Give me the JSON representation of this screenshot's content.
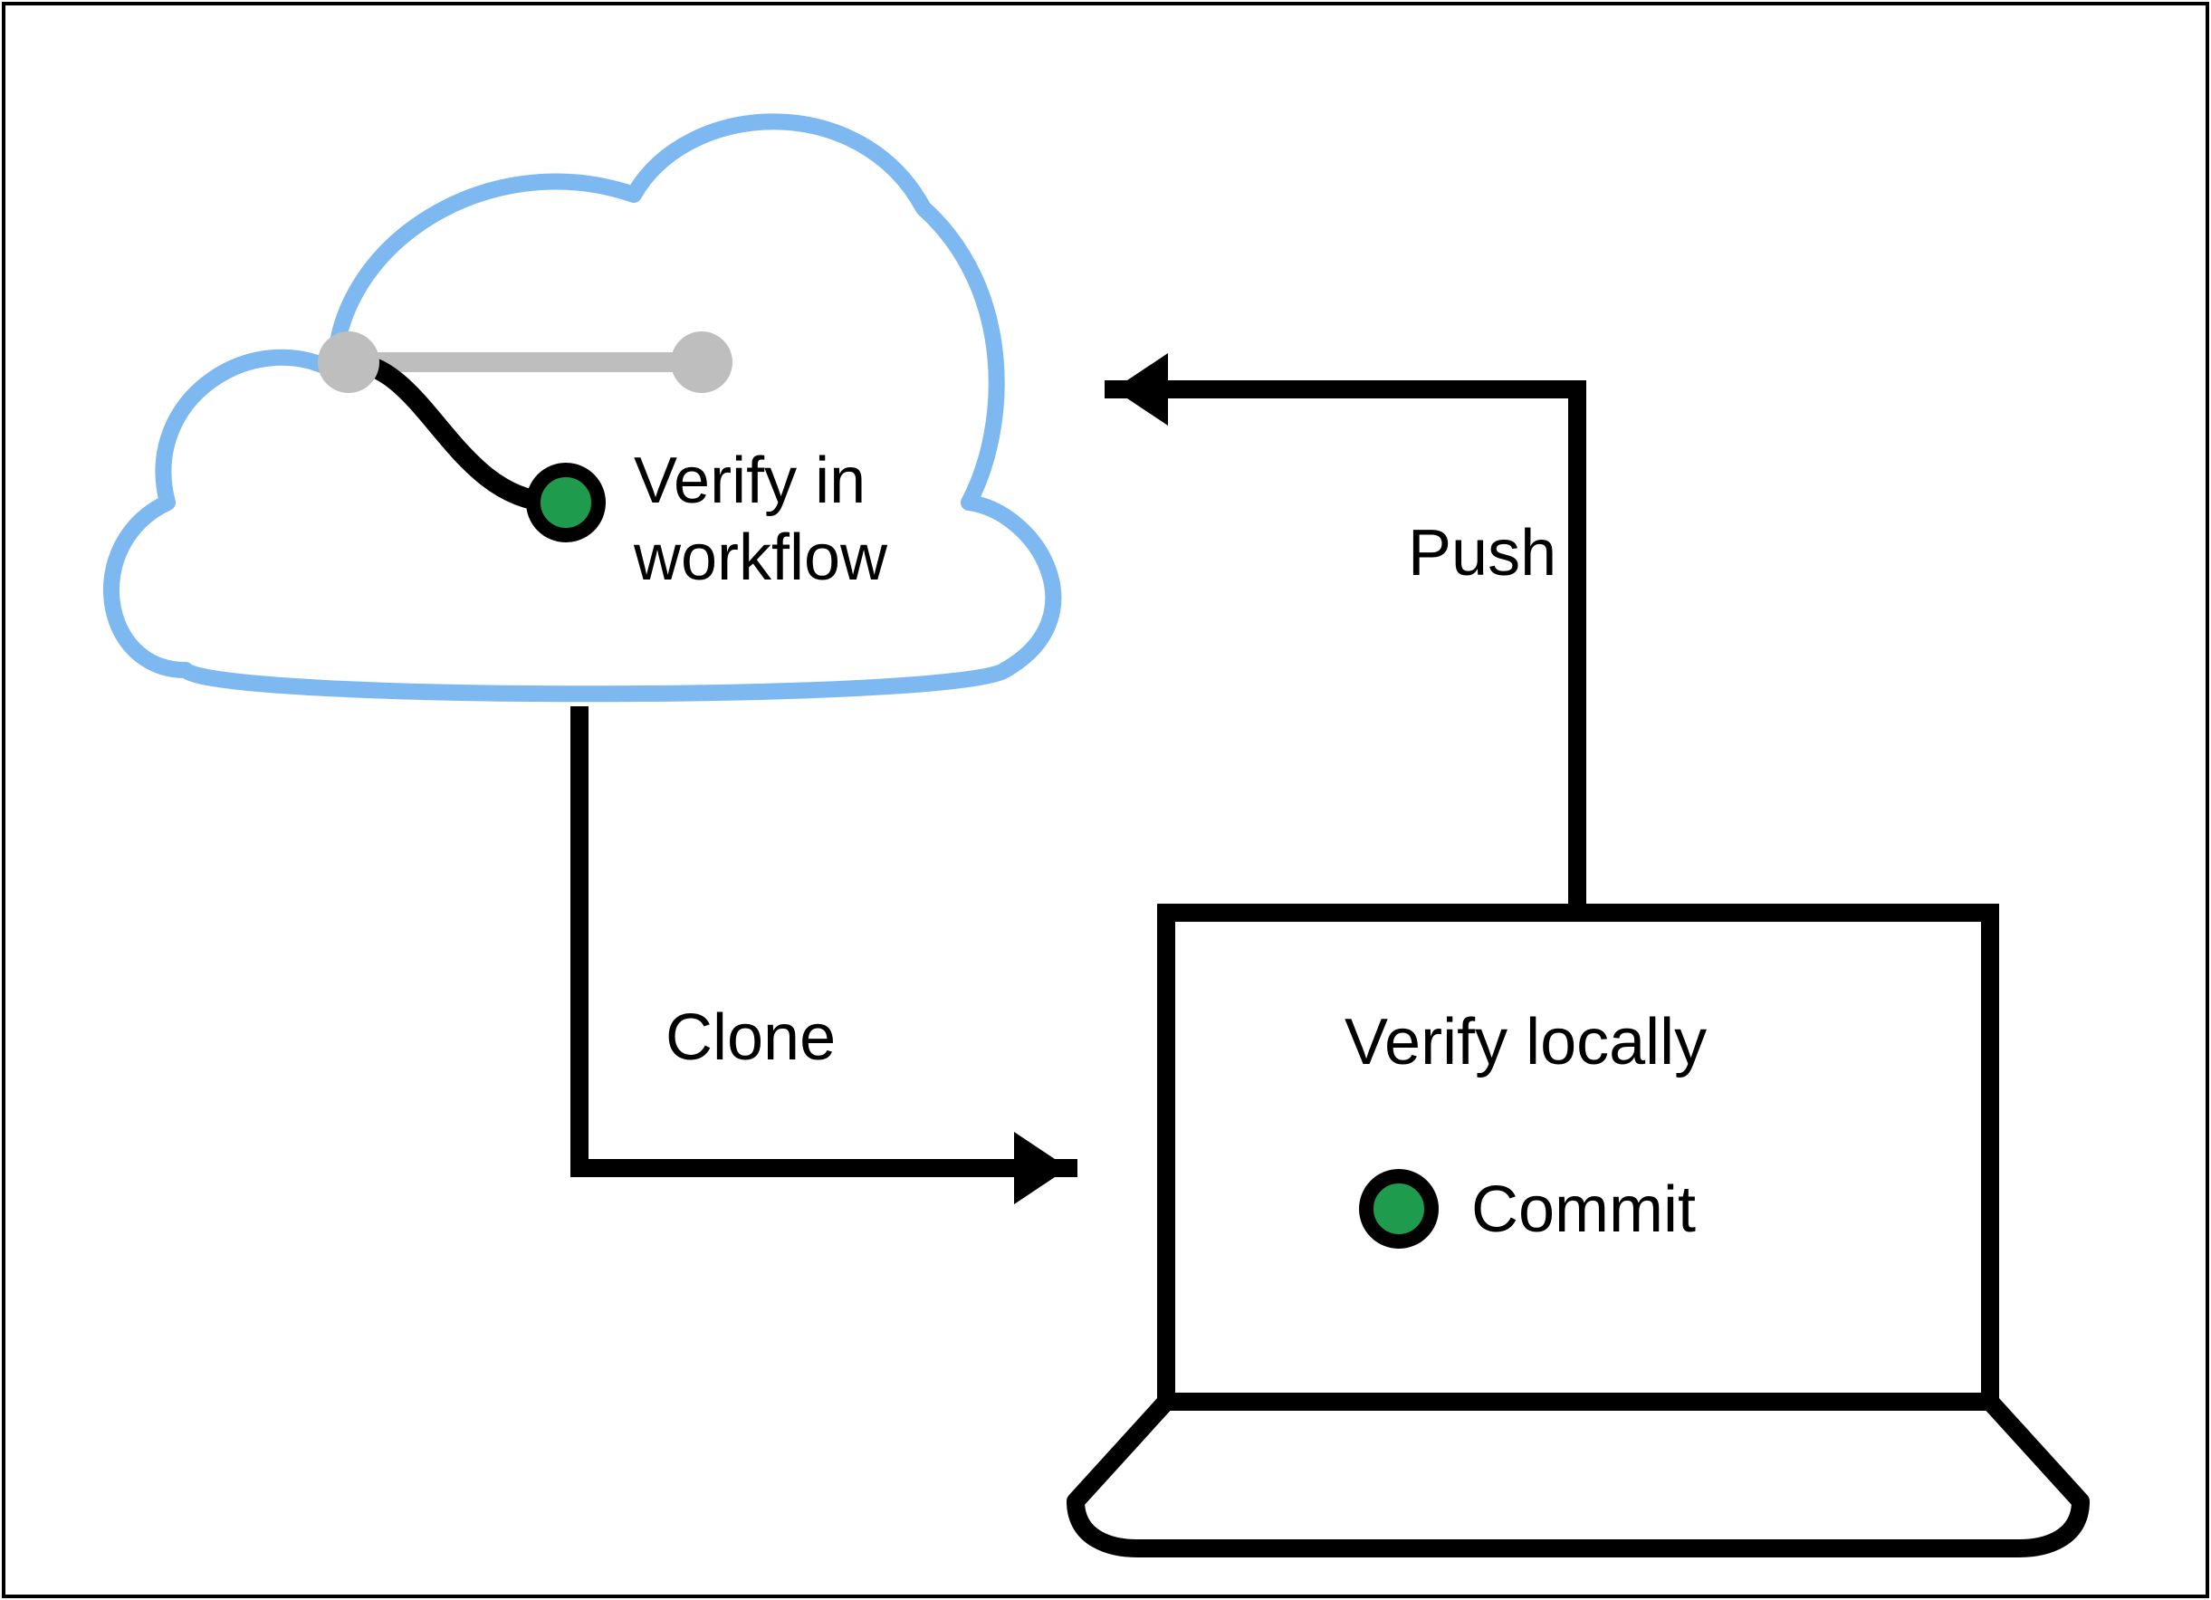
{
  "diagram": {
    "cloud_label_line1": "Verify in",
    "cloud_label_line2": "workflow",
    "laptop_label_line1": "Verify locally",
    "laptop_label_line2": "Commit",
    "arrow_clone_label": "Clone",
    "arrow_push_label": "Push",
    "colors": {
      "cloud_stroke": "#7DB8F0",
      "branch_gray": "#BEBEBE",
      "commit_green": "#1F9B4D",
      "black": "#000000"
    }
  }
}
